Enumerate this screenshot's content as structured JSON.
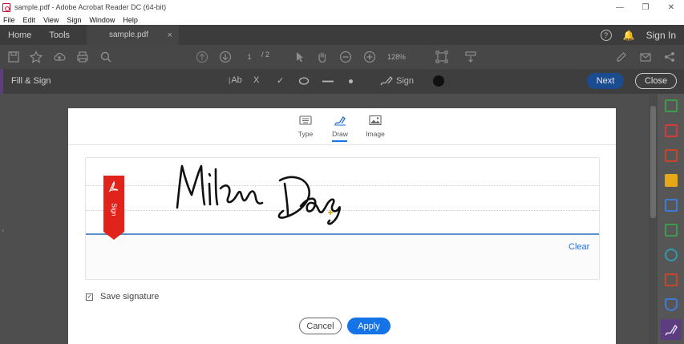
{
  "window": {
    "title": "sample.pdf - Adobe Acrobat Reader DC (64-bit)",
    "controls": [
      "—",
      "❐",
      "✕"
    ]
  },
  "menu": [
    "File",
    "Edit",
    "View",
    "Sign",
    "Window",
    "Help"
  ],
  "tabs": {
    "home": "Home",
    "tools": "Tools",
    "document": "sample.pdf",
    "document_close": "×",
    "sign_in": "Sign In",
    "help": "?"
  },
  "toolbar": {
    "page_current": "1",
    "page_total": "/ 2",
    "zoom": "128%"
  },
  "fill_sign": {
    "title": "Fill & Sign",
    "text_tool": "Ab",
    "cross_tool": "X",
    "check_tool": "✓",
    "sign_label": "Sign",
    "next": "Next",
    "close": "Close"
  },
  "dialog": {
    "modes": [
      {
        "label": "Type",
        "icon": "keyboard-icon"
      },
      {
        "label": "Draw",
        "icon": "pen-icon",
        "active": true
      },
      {
        "label": "Image",
        "icon": "image-icon"
      }
    ],
    "flag_text": "Sign",
    "clear": "Clear",
    "save_signature_label": "Save signature",
    "save_signature_checked": true,
    "checkbox_mark": "✓",
    "cancel": "Cancel",
    "apply": "Apply"
  },
  "colors": {
    "accent_blue": "#1473e6",
    "next_blue": "#1c4c90",
    "acrobat_red": "#e0231b",
    "fill_sign_purple": "#5b3d80"
  }
}
